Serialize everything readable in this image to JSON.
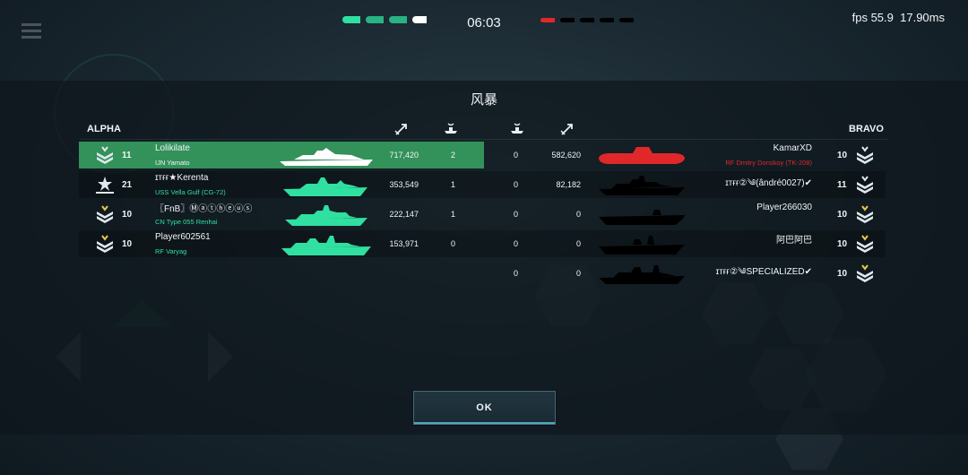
{
  "hud": {
    "timer": "06:03",
    "fps_text": "fps 55.9",
    "ms_text": "17.90ms",
    "ally_color": "#2fe0a0",
    "enemy_color": "#e0282a"
  },
  "screen": {
    "title": "风暴",
    "ok_label": "OK"
  },
  "teams": {
    "left_name": "ALPHA",
    "right_name": "BRAVO"
  },
  "alpha_players": [
    {
      "level": "11",
      "name": "Lolikilate",
      "ship": "IJN Yamato",
      "damage": "717,420",
      "kills": "2",
      "highlight": true
    },
    {
      "level": "21",
      "name": "ɪᴛғғ★Kerenta",
      "ship": "USS Vella Gulf (CG-72)",
      "damage": "353,549",
      "kills": "1",
      "highlight": false
    },
    {
      "level": "10",
      "name": "〖FnB〗Ⓜⓐⓣⓗⓔⓤⓢ",
      "ship": "CN Type 055 Renhai",
      "damage": "222,147",
      "kills": "1",
      "highlight": false
    },
    {
      "level": "10",
      "name": "Player602561",
      "ship": "RF Varyag",
      "damage": "153,971",
      "kills": "0",
      "highlight": false
    }
  ],
  "bravo_players": [
    {
      "level": "10",
      "name": "KamarXD",
      "ship": "RF Dmitry Donskoy (TK-208)",
      "damage": "582,620",
      "kills": "0",
      "alive": true
    },
    {
      "level": "11",
      "name": "ɪᴛғғ②༄(ândré0027)✔",
      "ship": "",
      "damage": "82,182",
      "kills": "0",
      "alive": false
    },
    {
      "level": "10",
      "name": "Player266030",
      "ship": "",
      "damage": "0",
      "kills": "0",
      "alive": false
    },
    {
      "level": "10",
      "name": "阿巴阿巴",
      "ship": "",
      "damage": "0",
      "kills": "0",
      "alive": false
    },
    {
      "level": "10",
      "name": "ɪᴛғғ②༄SPECIALIZED✔",
      "ship": "",
      "damage": "0",
      "kills": "0",
      "alive": false
    }
  ],
  "icons": {
    "damage_header": "damage-arrow-icon",
    "kills_header": "sinking-ship-icon",
    "rank": "chevron-rank-icon",
    "menu": "menu-icon"
  }
}
